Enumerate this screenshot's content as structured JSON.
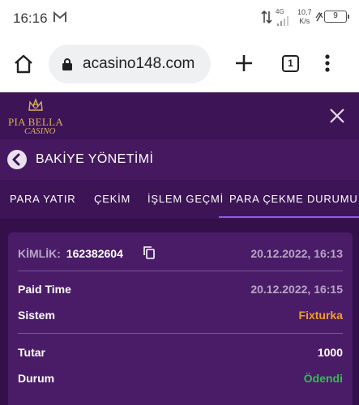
{
  "status_bar": {
    "time": "16:16",
    "network": "4G",
    "speed_value": "10,7",
    "speed_unit": "K/s",
    "battery": "9"
  },
  "browser": {
    "url": "acasino148.com",
    "tab_count": "1"
  },
  "site": {
    "logo_text": "PIA BELLA",
    "logo_subtext": "CASINO"
  },
  "page": {
    "title": "BAKİYE YÖNETİMİ"
  },
  "tabs": [
    {
      "label": "PARA YATIR"
    },
    {
      "label": "ÇEKİM"
    },
    {
      "label": "İŞLEM GEÇMİ"
    },
    {
      "label": "PARA ÇEKME DURUMU"
    }
  ],
  "active_tab": "PARA ÇEKME DURUMU",
  "withdrawal": {
    "id_label": "KİMLİK:",
    "id_value": "162382604",
    "created_at": "20.12.2022, 16:13",
    "paid_time_label": "Paid Time",
    "paid_time_value": "20.12.2022, 16:15",
    "system_label": "Sistem",
    "system_value": "Fixturka",
    "amount_label": "Tutar",
    "amount_value": "1000",
    "status_label": "Durum",
    "status_value": "Ödendi"
  },
  "colors": {
    "background": "#3d1456",
    "card": "#4a1c68",
    "accent": "#8b5cf6",
    "system_value": "#f0a01e",
    "status_paid": "#2fbf4a",
    "logo_gold": "#d8b15a"
  }
}
